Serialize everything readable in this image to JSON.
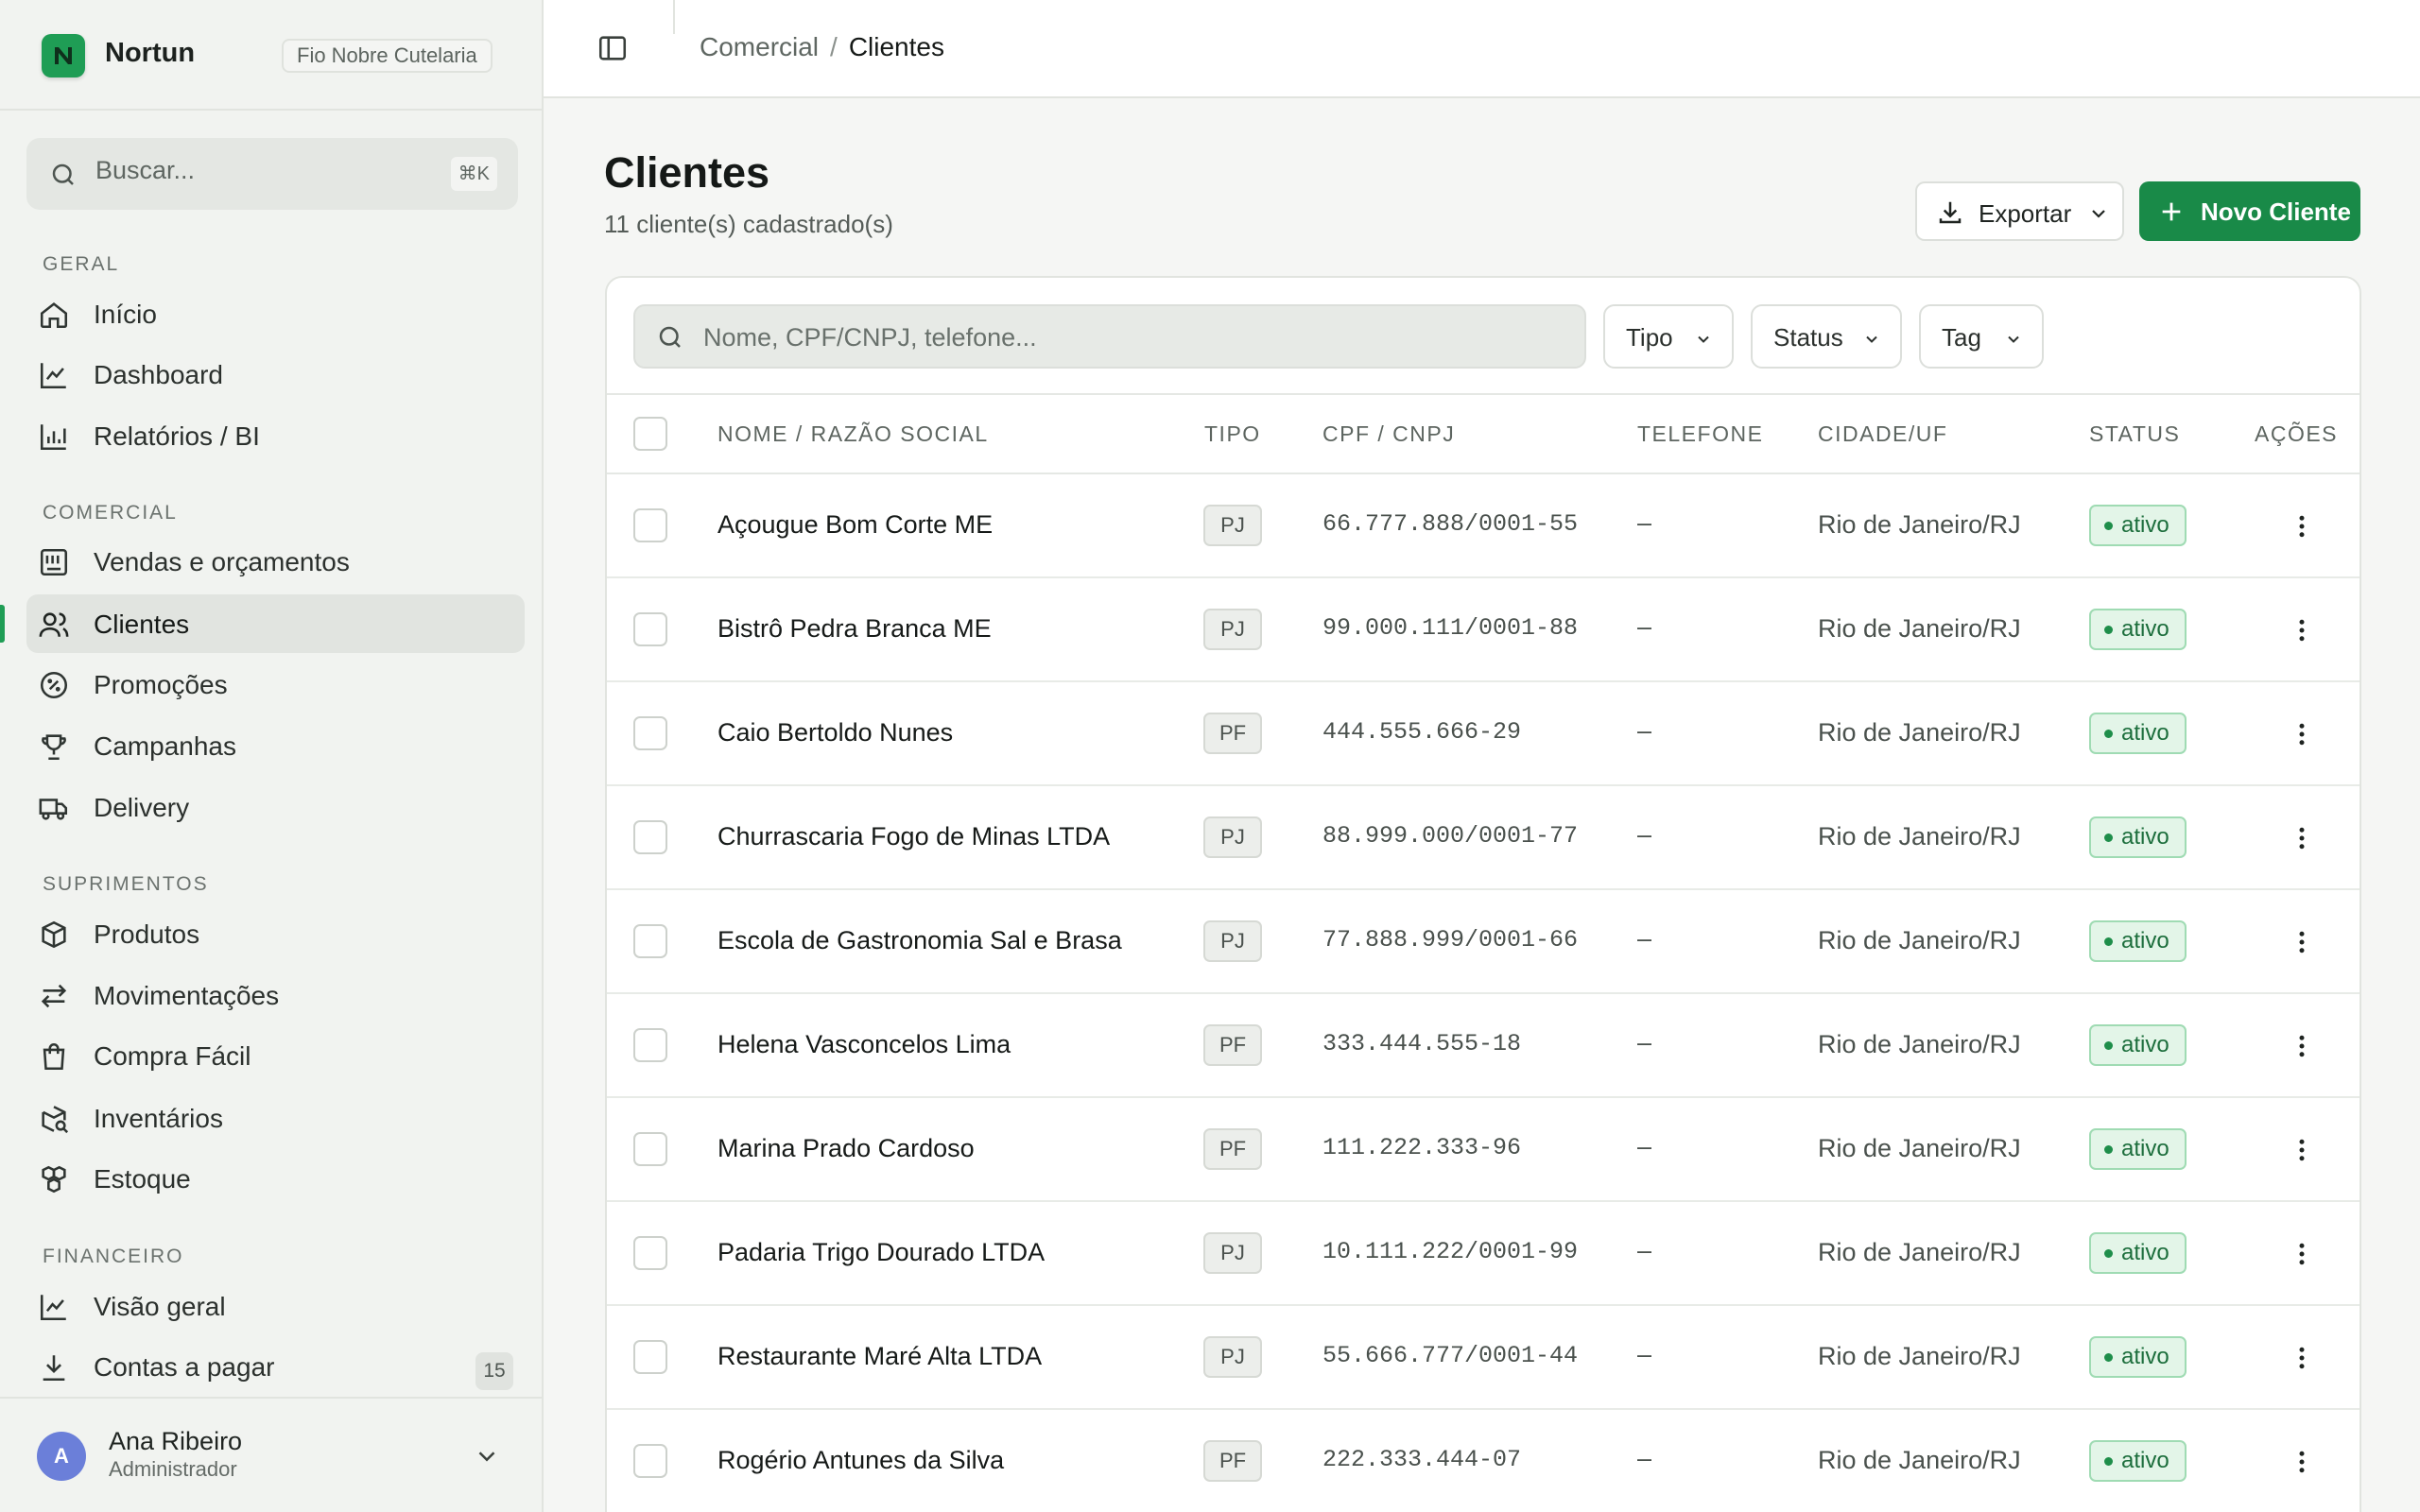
{
  "app": {
    "name": "Nortun",
    "workspace": "Fio Nobre Cutelaria"
  },
  "search": {
    "placeholder": "Buscar...",
    "shortcut": "⌘K"
  },
  "sidebar": {
    "sections": [
      {
        "label": "GERAL",
        "items": [
          {
            "label": "Início",
            "icon": "home-icon"
          },
          {
            "label": "Dashboard",
            "icon": "line-chart-icon"
          },
          {
            "label": "Relatórios / BI",
            "icon": "bar-chart-icon"
          }
        ]
      },
      {
        "label": "COMERCIAL",
        "items": [
          {
            "label": "Vendas e orçamentos",
            "icon": "register-icon"
          },
          {
            "label": "Clientes",
            "icon": "users-icon",
            "active": true
          },
          {
            "label": "Promoções",
            "icon": "percent-badge-icon"
          },
          {
            "label": "Campanhas",
            "icon": "trophy-icon"
          },
          {
            "label": "Delivery",
            "icon": "truck-icon"
          }
        ]
      },
      {
        "label": "SUPRIMENTOS",
        "items": [
          {
            "label": "Produtos",
            "icon": "package-icon"
          },
          {
            "label": "Movimentações",
            "icon": "arrows-left-right-icon"
          },
          {
            "label": "Compra Fácil",
            "icon": "shopping-bag-icon"
          },
          {
            "label": "Inventários",
            "icon": "package-search-icon"
          },
          {
            "label": "Estoque",
            "icon": "boxes-icon"
          }
        ]
      },
      {
        "label": "FINANCEIRO",
        "items": [
          {
            "label": "Visão geral",
            "icon": "line-chart-icon"
          },
          {
            "label": "Contas a pagar",
            "icon": "download-icon",
            "count": "15"
          }
        ]
      }
    ]
  },
  "user": {
    "initial": "A",
    "name": "Ana Ribeiro",
    "role": "Administrador"
  },
  "breadcrumb": {
    "parent": "Comercial",
    "separator": "/",
    "current": "Clientes"
  },
  "page": {
    "title": "Clientes",
    "subtitle": "11 cliente(s) cadastrado(s)"
  },
  "actions": {
    "export_label": "Exportar",
    "new_label": "Novo Cliente"
  },
  "filters": {
    "placeholder": "Nome, CPF/CNPJ, telefone...",
    "tipo": "Tipo",
    "status": "Status",
    "tag": "Tag"
  },
  "table": {
    "columns": [
      "NOME / RAZÃO SOCIAL",
      "TIPO",
      "CPF / CNPJ",
      "TELEFONE",
      "CIDADE/UF",
      "STATUS",
      "AÇÕES"
    ],
    "rows": [
      {
        "name": "Açougue Bom Corte ME",
        "tipo": "PJ",
        "doc": "66.777.888/0001-55",
        "tel": "–",
        "city": "Rio de Janeiro/RJ",
        "status": "ativo"
      },
      {
        "name": "Bistrô Pedra Branca ME",
        "tipo": "PJ",
        "doc": "99.000.111/0001-88",
        "tel": "–",
        "city": "Rio de Janeiro/RJ",
        "status": "ativo"
      },
      {
        "name": "Caio Bertoldo Nunes",
        "tipo": "PF",
        "doc": "444.555.666-29",
        "tel": "–",
        "city": "Rio de Janeiro/RJ",
        "status": "ativo"
      },
      {
        "name": "Churrascaria Fogo de Minas LTDA",
        "tipo": "PJ",
        "doc": "88.999.000/0001-77",
        "tel": "–",
        "city": "Rio de Janeiro/RJ",
        "status": "ativo"
      },
      {
        "name": "Escola de Gastronomia Sal e Brasa",
        "tipo": "PJ",
        "doc": "77.888.999/0001-66",
        "tel": "–",
        "city": "Rio de Janeiro/RJ",
        "status": "ativo"
      },
      {
        "name": "Helena Vasconcelos Lima",
        "tipo": "PF",
        "doc": "333.444.555-18",
        "tel": "–",
        "city": "Rio de Janeiro/RJ",
        "status": "ativo"
      },
      {
        "name": "Marina Prado Cardoso",
        "tipo": "PF",
        "doc": "111.222.333-96",
        "tel": "–",
        "city": "Rio de Janeiro/RJ",
        "status": "ativo"
      },
      {
        "name": "Padaria Trigo Dourado LTDA",
        "tipo": "PJ",
        "doc": "10.111.222/0001-99",
        "tel": "–",
        "city": "Rio de Janeiro/RJ",
        "status": "ativo"
      },
      {
        "name": "Restaurante Maré Alta LTDA",
        "tipo": "PJ",
        "doc": "55.666.777/0001-44",
        "tel": "–",
        "city": "Rio de Janeiro/RJ",
        "status": "ativo"
      },
      {
        "name": "Rogério Antunes da Silva",
        "tipo": "PF",
        "doc": "222.333.444-07",
        "tel": "–",
        "city": "Rio de Janeiro/RJ",
        "status": "ativo"
      }
    ]
  },
  "colors": {
    "accent": "#198a48",
    "status_bg": "#e3f5e8",
    "status_text": "#1c6e3c"
  }
}
